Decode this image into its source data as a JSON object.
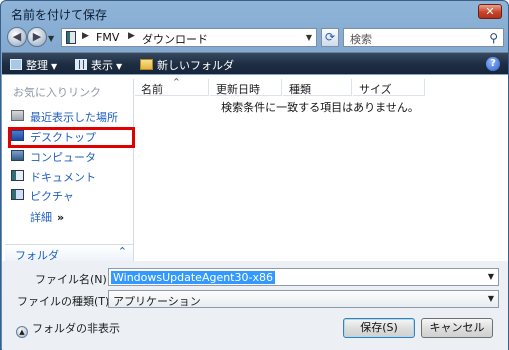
{
  "window": {
    "title": "名前を付けて保存",
    "close_glyph": "✕"
  },
  "nav": {
    "back_glyph": "◀",
    "forward_glyph": "▶",
    "breadcrumbs": [
      "FMV",
      "ダウンロード"
    ],
    "search_placeholder": "検索"
  },
  "toolbar": {
    "organize": "整理",
    "views": "表示",
    "new_folder": "新しいフォルダ",
    "help_glyph": "?"
  },
  "sidebar": {
    "header": "お気に入りリンク",
    "items": [
      {
        "label": "最近表示した場所",
        "icon": "recent-places-icon"
      },
      {
        "label": "デスクトップ",
        "icon": "desktop-icon"
      },
      {
        "label": "コンピュータ",
        "icon": "computer-icon"
      },
      {
        "label": "ドキュメント",
        "icon": "documents-icon"
      },
      {
        "label": "ピクチャ",
        "icon": "pictures-icon"
      }
    ],
    "more": "詳細",
    "more_arrows": "»",
    "folders": "フォルダ"
  },
  "filelist": {
    "columns": [
      "名前",
      "更新日時",
      "種類",
      "サイズ"
    ],
    "empty_message": "検索条件に一致する項目はありません。"
  },
  "form": {
    "filename_label": "ファイル名(N):",
    "filename_value": "WindowsUpdateAgent30-x86",
    "filetype_label": "ファイルの種類(T):",
    "filetype_value": "アプリケーション",
    "hide_folders": "フォルダの非表示",
    "save_button": "保存(S)",
    "cancel_button": "キャンセル"
  },
  "colors": {
    "highlight": "#e00000",
    "link": "#1f5fbf",
    "selection": "#3399ff"
  }
}
